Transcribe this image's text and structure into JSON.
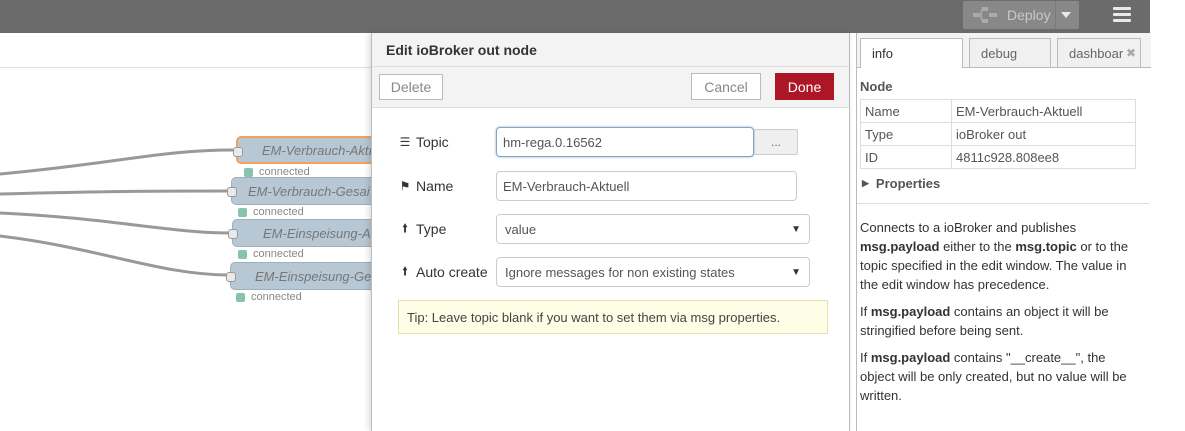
{
  "header": {
    "deploy_label": "Deploy"
  },
  "workspace": {
    "nodes": [
      {
        "label": "EM-Verbrauch-Aktı",
        "status": "connected"
      },
      {
        "label": "EM-Verbrauch-Gesai",
        "status": "connected"
      },
      {
        "label": "EM-Einspeisung-A",
        "status": "connected"
      },
      {
        "label": "EM-Einspeisung-Ge",
        "status": "connected"
      }
    ]
  },
  "tray": {
    "title": "Edit ioBroker out node",
    "delete_label": "Delete",
    "cancel_label": "Cancel",
    "done_label": "Done",
    "topic": {
      "label": "Topic",
      "value": "hm-rega.0.16562",
      "browse_label": "..."
    },
    "name": {
      "label": "Name",
      "value": "EM-Verbrauch-Aktuell"
    },
    "type": {
      "label": "Type",
      "value": "value"
    },
    "autocreate": {
      "label": "Auto create",
      "value": "Ignore messages for non existing states"
    },
    "tip": "Tip: Leave topic blank if you want to set them via msg properties."
  },
  "sidebar": {
    "tabs": [
      {
        "label": "info"
      },
      {
        "label": "debug"
      },
      {
        "label": "dashboar"
      }
    ],
    "node_section": "Node",
    "node_rows": [
      {
        "key": "Name",
        "value": "EM-Verbrauch-Aktuell"
      },
      {
        "key": "Type",
        "value": "ioBroker out"
      },
      {
        "key": "ID",
        "value": "4811c928.808ee8"
      }
    ],
    "properties_label": "Properties",
    "help": {
      "p1_a": "Connects to a ioBroker and publishes ",
      "p1_b": "msg.payload",
      "p1_c": " either to the ",
      "p1_d": "msg.topic",
      "p1_e": " or to the topic specified in the edit window. The value in the edit window has precedence.",
      "p2_a": "If ",
      "p2_b": "msg.payload",
      "p2_c": " contains an object it will be stringified before being sent.",
      "p3_a": "If ",
      "p3_b": "msg.payload",
      "p3_c": " contains \"__create__\", the object will be only created, but no value will be written."
    }
  },
  "colors": {
    "header_bg": "#6b6b6b",
    "done_button": "#ad1625",
    "node_fill": "#b7c7d4",
    "selected_border": "#f1a35e",
    "tip_bg": "#fefde6"
  }
}
